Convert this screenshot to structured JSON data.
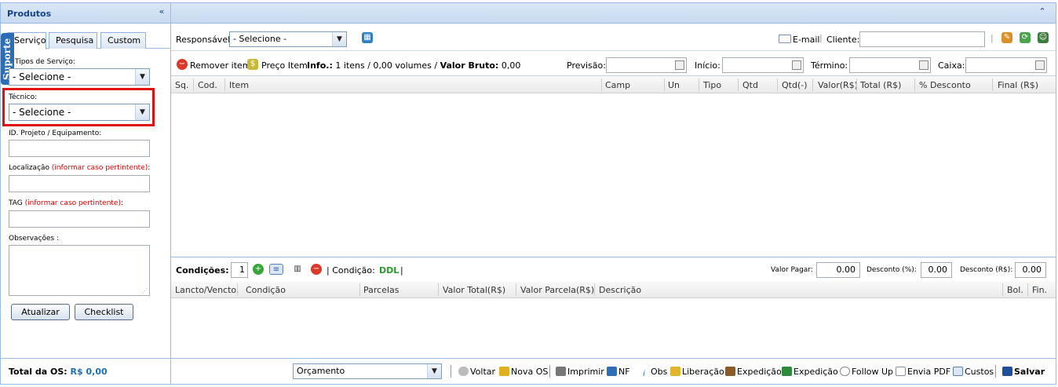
{
  "left_panel": {
    "title": "Produtos",
    "tabs": [
      "Serviço",
      "Pesquisa",
      "Custom"
    ],
    "suporte": "Suporte",
    "fields": {
      "tipos_servico_label": "Tipos de Serviço:",
      "tipos_servico_value": "- Selecione -",
      "tecnico_label": "Técnico:",
      "tecnico_value": "- Selecione -",
      "id_projeto_label": "ID. Projeto / Equipamento:",
      "localizacao_label": "Localização",
      "localizacao_hint": "(informar caso pertintente)",
      "tag_label": "TAG",
      "tag_hint": "(informar caso pertintente)",
      "colon": ":",
      "observacoes_label": "Observações :"
    },
    "buttons": {
      "atualizar": "Atualizar",
      "checklist": "Checklist"
    },
    "total_label": "Total da OS:",
    "total_value": "R$ 0,00"
  },
  "toolbar": {
    "responsavel_label": "Responsável:",
    "responsavel_value": "- Selecione -",
    "email": "E-mail",
    "cliente_label": "Cliente:"
  },
  "items_bar": {
    "remover": "Remover item",
    "preco": "Preço Item",
    "info_label": "Info.:",
    "info_value": "1 itens / 0,00 volumes /",
    "valor_bruto_label": "Valor Bruto:",
    "valor_bruto_value": "0,00",
    "previsao": "Previsão:",
    "inicio": "Início:",
    "termino": "Término:",
    "caixa": "Caixa:"
  },
  "items_columns": [
    "Sq.",
    "Cod.",
    "Item",
    "Camp",
    "Un",
    "Tipo",
    "Qtd",
    "Qtd(-)",
    "Valor(R$)",
    "Total (R$)",
    "% Desconto",
    "Final (R$)"
  ],
  "conditions": {
    "label": "Condições:",
    "qty": "1",
    "condicao_label": "| Condição:",
    "condicao_value": "DDL",
    "pipe": "|",
    "valor_pagar_label": "Valor Pagar:",
    "valor_pagar": "0.00",
    "desconto_pct_label": "Desconto (%):",
    "desconto_pct": "0.00",
    "desconto_rs_label": "Desconto (R$):",
    "desconto_rs": "0.00"
  },
  "payment_columns": [
    "Lancto/Vencto.",
    "Condição",
    "Parcelas",
    "Valor Total(R$)",
    "Valor Parcela(R$)",
    "Descrição",
    "Bol.",
    "Fin."
  ],
  "footer": {
    "status_value": "Orçamento",
    "actions": [
      "Voltar",
      "Nova OS",
      "Imprimir",
      "NF",
      "Obs",
      "Liberação",
      "Expedição",
      "Expedição",
      "Follow Up",
      "Envia PDF",
      "Custos",
      "Salvar"
    ]
  },
  "colors": {
    "header_bg": "#c7daf1",
    "border": "#99bbe8",
    "highlight": "#e01010",
    "link_blue": "#1c6fb0",
    "ddl_green": "#2a9a2a"
  }
}
